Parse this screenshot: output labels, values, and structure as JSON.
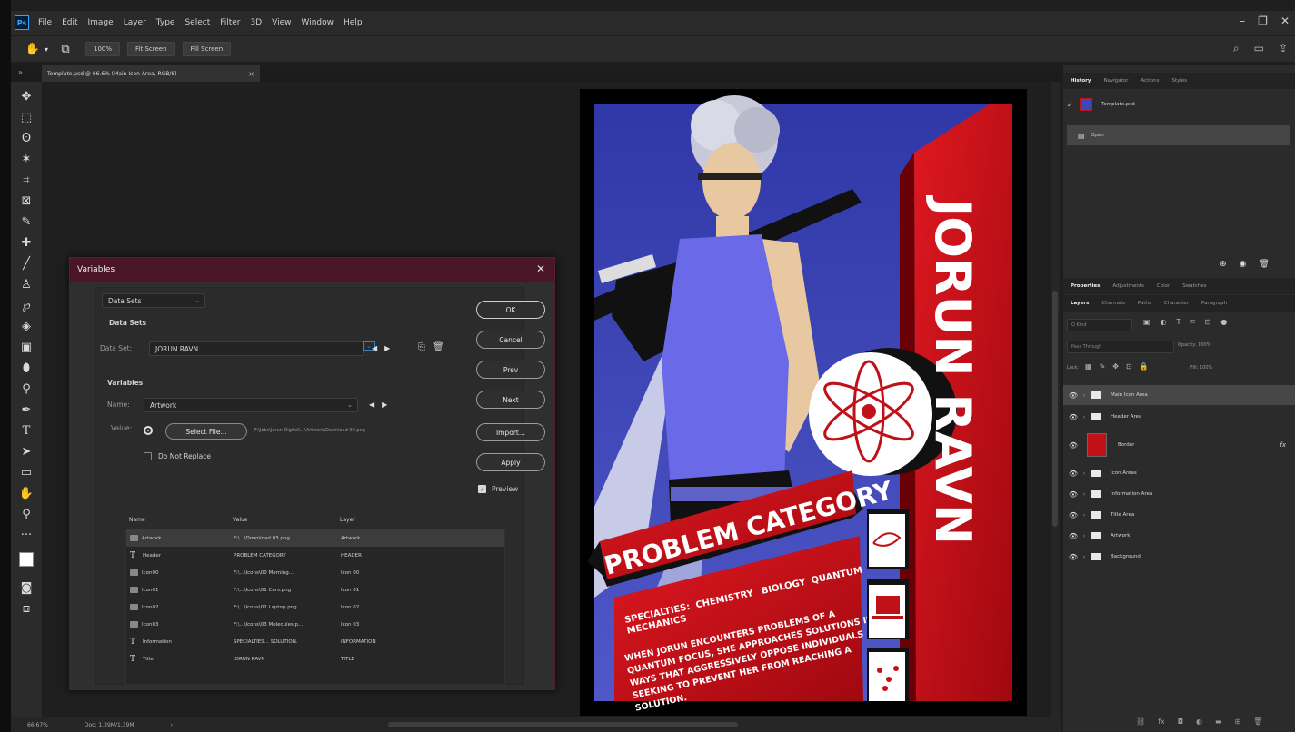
{
  "app": {
    "logo": "Ps"
  },
  "menu": [
    "File",
    "Edit",
    "Image",
    "Layer",
    "Type",
    "Select",
    "Filter",
    "3D",
    "View",
    "Window",
    "Help"
  ],
  "options": {
    "zoom_btn": "100%",
    "fit_btn": "Fit Screen",
    "fill_btn": "Fill Screen"
  },
  "document_tab": {
    "title": "Template.psd @ 66.6% (Main Icon Area, RGB/8)",
    "close": "×"
  },
  "status": {
    "zoom": "66.67%",
    "doc": "Doc: 1.39M/1.39M",
    "more": "›"
  },
  "poster": {
    "name": "JORUN RAVN",
    "category": "PROBLEM CATEGORY",
    "specialties": [
      "SPECIALTIES:",
      "CHEMISTRY",
      "BIOLOGY",
      "QUANTUM",
      "MECHANICS"
    ],
    "bio": [
      "WHEN JORUN ENCOUNTERS PROBLEMS OF A",
      "QUANTUM FOCUS, SHE APPROACHES SOLUTIONS IN",
      "WAYS THAT AGGRESSIVELY OPPOSE INDIVIDUALS",
      "SEEKING TO PREVENT HER FROM REACHING A",
      "SOLUTION."
    ],
    "colors": {
      "blue": "#3e48b0",
      "red": "#cc1018",
      "black": "#000000"
    }
  },
  "dialog": {
    "title": "Variables",
    "close": "✕",
    "section_dropdown": "Data Sets",
    "datasets_heading": "Data Sets",
    "dataset_label": "Data Set:",
    "dataset_value": "JORUN RAVN",
    "variables_heading": "Variables",
    "name_label": "Name:",
    "name_value": "Artwork",
    "value_label": "Value:",
    "select_file": "Select File...",
    "file_path": "F:\\Jobs\\Jorun Digital\\...\\Artwork\\Download 03.png",
    "do_not_replace": "Do Not Replace",
    "columns": [
      "Name",
      "Value",
      "Layer"
    ],
    "rows": [
      {
        "icon": "image",
        "name": "Artwork",
        "value": "F:\\...\\Download 03.png",
        "layer": "Artwork"
      },
      {
        "icon": "text",
        "name": "Header",
        "value": "PROBLEM CATEGORY",
        "layer": "HEADER"
      },
      {
        "icon": "image",
        "name": "Icon00",
        "value": "F:\\...\\Icons\\00 Morning...",
        "layer": "Icon 00"
      },
      {
        "icon": "image",
        "name": "Icon01",
        "value": "F:\\...\\Icons\\01 Cars.png",
        "layer": "Icon 01"
      },
      {
        "icon": "image",
        "name": "Icon02",
        "value": "F:\\...\\Icons\\02 Laptop.png",
        "layer": "Icon 02"
      },
      {
        "icon": "image",
        "name": "Icon03",
        "value": "F:\\...\\Icons\\03 Molecules.p...",
        "layer": "Icon 03"
      },
      {
        "icon": "text",
        "name": "Information",
        "value": "SPECIALTIES... SOLUTION.",
        "layer": "INFORMATION"
      },
      {
        "icon": "text",
        "name": "Title",
        "value": "JORUN RAVN",
        "layer": "TITLE"
      }
    ],
    "buttons": {
      "ok": "OK",
      "cancel": "Cancel",
      "prev": "Prev",
      "next": "Next",
      "import": "Import...",
      "apply": "Apply"
    },
    "preview_label": "Preview",
    "preview_checked": true
  },
  "panels": {
    "history_tabs": [
      "History",
      "Navigator",
      "Actions",
      "Styles"
    ],
    "history_items": [
      "Template.psd",
      "Open"
    ],
    "props_tabs": [
      "Properties",
      "Adjustments",
      "Color",
      "Swatches"
    ],
    "layers_tabs": [
      "Layers",
      "Channels",
      "Paths",
      "Character",
      "Paragraph"
    ],
    "kind_label": "Q Kind",
    "blend_mode": "Pass Through",
    "opacity": "Opacity: 100%",
    "lock_label": "Lock:",
    "fill": "Fill: 100%",
    "layers": [
      {
        "name": "Main Icon Area",
        "type": "folder",
        "selected": true
      },
      {
        "name": "Header Area",
        "type": "folder"
      },
      {
        "name": "Border",
        "type": "thumb",
        "fx": "fx"
      },
      {
        "name": "Icon Areas",
        "type": "folder"
      },
      {
        "name": "Information Area",
        "type": "folder"
      },
      {
        "name": "Title Area",
        "type": "folder"
      },
      {
        "name": "Artwork",
        "type": "folder"
      },
      {
        "name": "Background",
        "type": "folder"
      }
    ]
  }
}
